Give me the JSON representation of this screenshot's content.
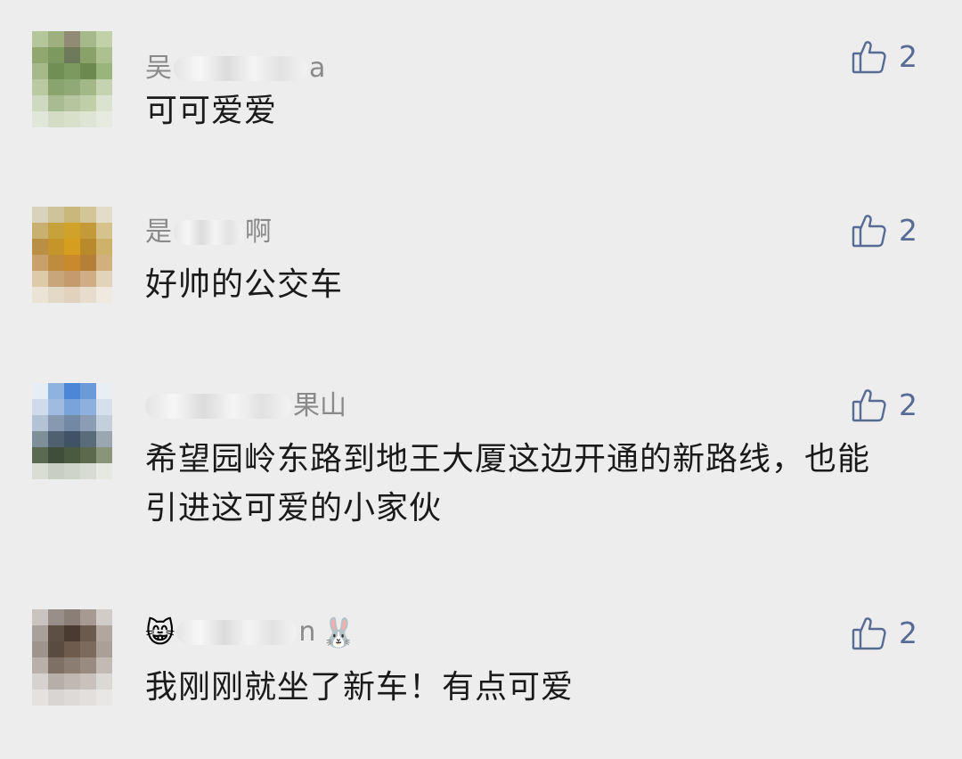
{
  "comments": [
    {
      "name_prefix": "吴",
      "name_suffix": "a",
      "name_icons": [],
      "text": "可可爱爱",
      "likes": "2",
      "avatar_colors": [
        "#b4c79b",
        "#9db07d",
        "#8f8b74",
        "#a6b98a",
        "#c2d1a8",
        "#90a870",
        "#7d9a5e",
        "#6f7a5a",
        "#88a26a",
        "#adc08f",
        "#a5b98a",
        "#6f8f55",
        "#7a9a60",
        "#6c8a4e",
        "#9ab57c",
        "#b9c9a0",
        "#8aa46d",
        "#91a976",
        "#a2b887",
        "#c6d3b0",
        "#cfd8c0",
        "#a9bb90",
        "#b5c59d",
        "#c0cfa8",
        "#dbe2d0",
        "#e0e6d8",
        "#d4dcc6",
        "#d8e0cb",
        "#dfe5d4",
        "#e6eadf"
      ]
    },
    {
      "name_prefix": "是",
      "name_suffix": "啊",
      "name_icons": [],
      "text": "好帅的公交车",
      "likes": "2",
      "avatar_colors": [
        "#d9d2bd",
        "#cfc39a",
        "#c8b97a",
        "#d3c596",
        "#e2dcc8",
        "#c9b070",
        "#c7a23a",
        "#d0a22a",
        "#c49a38",
        "#d6c28c",
        "#b88f45",
        "#c6952a",
        "#d59e1e",
        "#b98a2c",
        "#cfb26a",
        "#c7a06a",
        "#be8c3c",
        "#c98a2e",
        "#b57f38",
        "#d2b07e",
        "#dccaa8",
        "#c9a57c",
        "#c59a6c",
        "#d0ad84",
        "#e2d3bb",
        "#ebe3d6",
        "#e4d8c6",
        "#e0d2bd",
        "#e7dccd",
        "#efe9df"
      ]
    },
    {
      "name_prefix": "",
      "name_suffix": "果山",
      "name_icons": [],
      "text": "希望园岭东路到地王大厦这边开通的新路线，也能引进这可爱的小家伙",
      "likes": "2",
      "avatar_colors": [
        "#e6edf5",
        "#8fb3e0",
        "#4b87d6",
        "#6a9ad8",
        "#e9eef4",
        "#cfdbea",
        "#9fbbe0",
        "#7aa3dc",
        "#8eb0de",
        "#d6e0ec",
        "#b3c2d4",
        "#8799b0",
        "#7289a6",
        "#8a9db5",
        "#c4cfdc",
        "#7f8f9a",
        "#4f6070",
        "#3f5266",
        "#5a6b7a",
        "#9aa6b0",
        "#5a6a52",
        "#3e4e3a",
        "#4a5a40",
        "#5b6a4a",
        "#8a9478",
        "#d9ddd3",
        "#c8cec1",
        "#cfd4c8",
        "#d8dbd2",
        "#e6e8e2"
      ]
    },
    {
      "name_prefix": "",
      "name_suffix": "n",
      "name_icons": [
        "cat-emoji-icon",
        "rabbit-emoji-icon"
      ],
      "cat_glyph": "😸",
      "rabbit_glyph": "🐰",
      "text": "我刚刚就坐了新车！有点可爱",
      "likes": "2",
      "avatar_colors": [
        "#c9c4c0",
        "#9a8f88",
        "#8a7e76",
        "#a69a92",
        "#d2ccc8",
        "#a8a09a",
        "#5e4f45",
        "#4a3b32",
        "#6b5a4e",
        "#b1a79f",
        "#9e948c",
        "#5a4b40",
        "#6e5b4c",
        "#7c6a5c",
        "#aaa097",
        "#b8b0a9",
        "#7f7066",
        "#8c7d72",
        "#998b80",
        "#c2bab3",
        "#d6d2cf",
        "#b6aea8",
        "#c0b8b2",
        "#c9c2bc",
        "#dcd8d5",
        "#e4e1df",
        "#d9d5d2",
        "#dedad7",
        "#e2dfdc",
        "#e9e7e5"
      ]
    }
  ],
  "colors": {
    "background": "#ededed",
    "link_blue": "#576b95",
    "name_gray": "#8a8a8a",
    "text_dark": "#1a1a1a"
  }
}
